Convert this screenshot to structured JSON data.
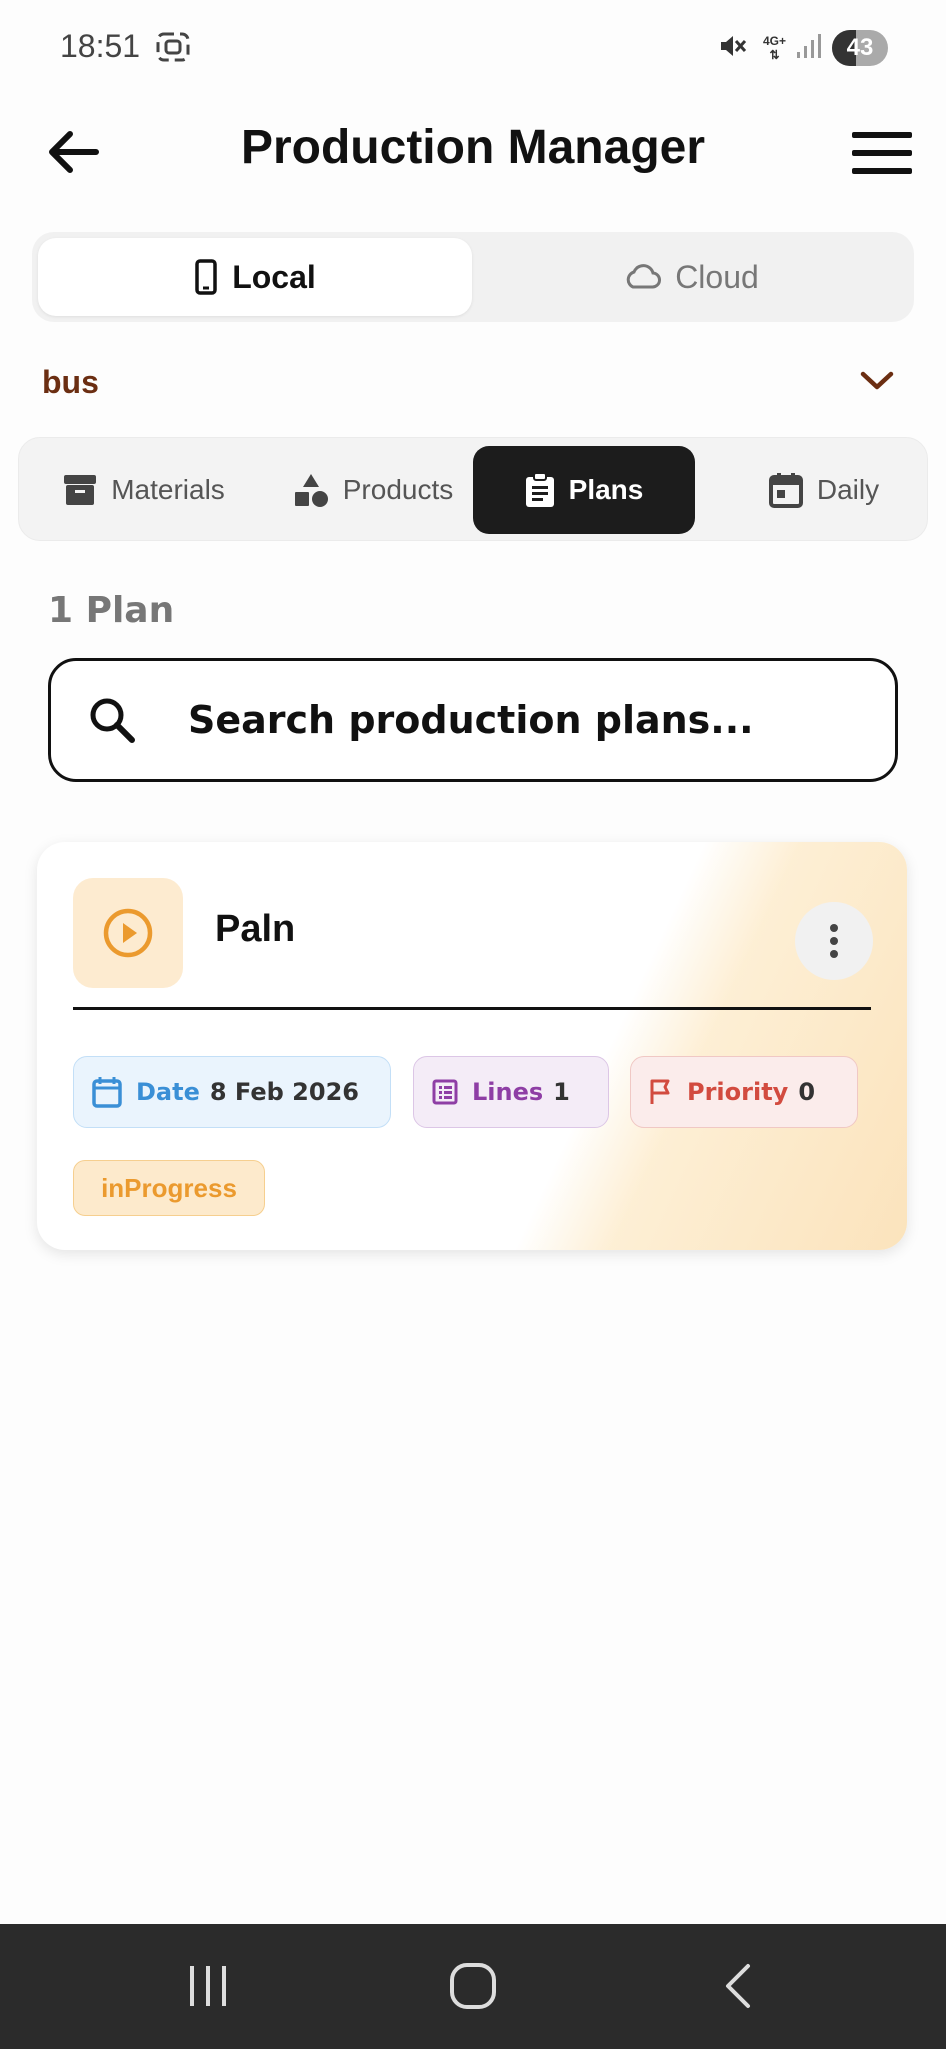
{
  "status_bar": {
    "time": "18:51",
    "network": "4G+",
    "battery": "43",
    "icons": [
      "screenshot-icon",
      "mute-icon",
      "signal-icon"
    ]
  },
  "app_bar": {
    "title": "Production Manager",
    "back_icon": "arrow-left-icon",
    "menu_icon": "hamburger-menu-icon"
  },
  "storage_toggle": {
    "options": [
      {
        "label": "Local",
        "icon": "smartphone-icon",
        "selected": true
      },
      {
        "label": "Cloud",
        "icon": "cloud-icon",
        "selected": false
      }
    ]
  },
  "project_selector": {
    "value": "bus",
    "icon": "chevron-down-icon",
    "color": "#6b2e12"
  },
  "tabs": [
    {
      "label": "Materials",
      "icon": "archive-box-icon",
      "selected": false
    },
    {
      "label": "Products",
      "icon": "shapes-icon",
      "selected": false
    },
    {
      "label": "Plans",
      "icon": "clipboard-icon",
      "selected": true
    },
    {
      "label": "Daily",
      "icon": "calendar-icon",
      "selected": false
    }
  ],
  "plan_count": "1 Plan",
  "search": {
    "placeholder": "Search production plans...",
    "value": ""
  },
  "plans": [
    {
      "title": "Paln",
      "icon": "play-circle-icon",
      "date_label": "Date",
      "date_value": "8 Feb 2026",
      "lines_label": "Lines",
      "lines_value": "1",
      "priority_label": "Priority",
      "priority_value": "0",
      "status": "inProgress",
      "status_color": "#eb9a2e"
    }
  ],
  "nav_bar": {
    "icons": [
      "recent-apps-icon",
      "home-icon",
      "back-icon"
    ]
  }
}
